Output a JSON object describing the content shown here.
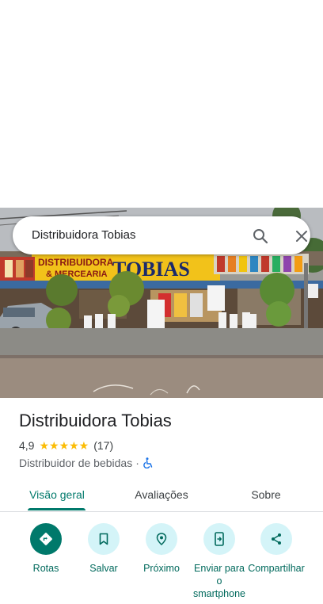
{
  "search": {
    "query": "Distribuidora Tobias"
  },
  "photo": {
    "sign_left_line1": "DISTRIBUIDORA",
    "sign_left_line2": "& MERCEARIA",
    "sign_main": "TOBIAS"
  },
  "place": {
    "name": "Distribuidora Tobias",
    "rating": "4,9",
    "stars": "★★★★★",
    "review_count": "(17)",
    "category": "Distribuidor de bebidas",
    "separator": "·"
  },
  "tabs": [
    {
      "label": "Visão geral",
      "active": true
    },
    {
      "label": "Avaliações",
      "active": false
    },
    {
      "label": "Sobre",
      "active": false
    }
  ],
  "actions": [
    {
      "label": "Rotas",
      "icon": "directions-icon"
    },
    {
      "label": "Salvar",
      "icon": "bookmark-icon"
    },
    {
      "label": "Próximo",
      "icon": "nearby-icon"
    },
    {
      "label": "Enviar para o smartphone",
      "icon": "send-to-phone-icon"
    },
    {
      "label": "Compartilhar",
      "icon": "share-icon"
    }
  ],
  "colors": {
    "accent": "#00796b",
    "action_bg": "#d4f4f8",
    "star": "#fbbc04",
    "accessibility": "#1a73e8"
  }
}
